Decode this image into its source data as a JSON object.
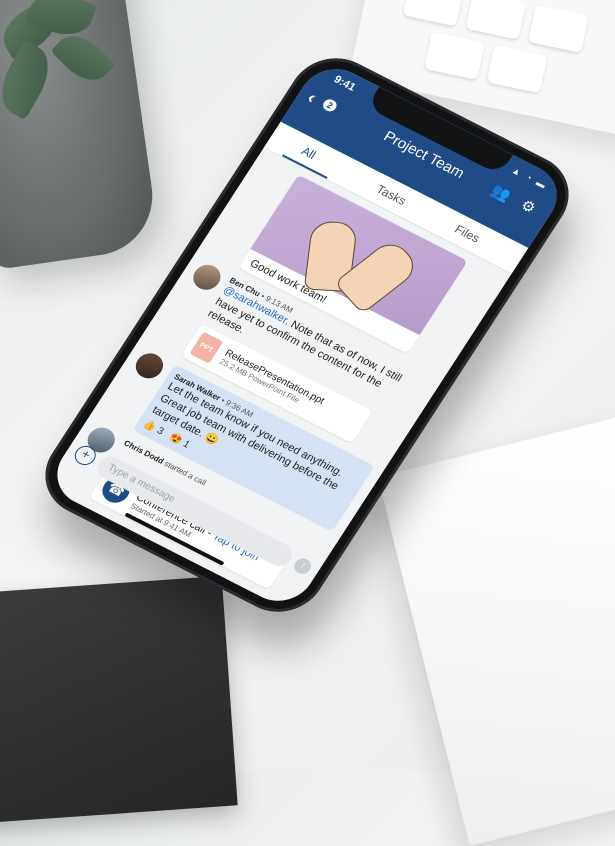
{
  "status": {
    "time": "9:41",
    "icons": "▲ ◔ ▬"
  },
  "header": {
    "back_glyph": "‹",
    "back_count": "2",
    "title": "Project Team",
    "people_icon": "people-icon",
    "settings_icon": "settings-icon"
  },
  "tabs": [
    {
      "label": "All"
    },
    {
      "label": "Tasks"
    },
    {
      "label": "Files"
    }
  ],
  "messages": {
    "image_caption": "Good work team!",
    "ben": {
      "name": "Ben Chu",
      "time": "9:13 AM",
      "mention": "@sarahwalker",
      "text": ". Note that as of now, I still have yet to confirm the content for the release."
    },
    "file": {
      "badge": "PPT",
      "name": "ReleasePresentation.ppt",
      "size": "25.2 MB PowerPoint File"
    },
    "sarah": {
      "name": "Sarah Walker",
      "time": "9:36 AM",
      "text1": "Let the team know if you need anything.",
      "text2": "Great job team with delivering before the target date. 😀"
    },
    "reactions": {
      "thumbs": "👍 3",
      "smile": "😍 1"
    },
    "chris": {
      "name": "Chris Dodd",
      "action": "started a call"
    },
    "call": {
      "title": "Conference call - ",
      "join": "Tap to join",
      "sub": "Started at 9:41 AM"
    }
  },
  "composer": {
    "placeholder": "Type a message"
  },
  "colors": {
    "brand": "#1f4b86",
    "link": "#1f6fd1",
    "highlight": "#d5e2f3"
  }
}
